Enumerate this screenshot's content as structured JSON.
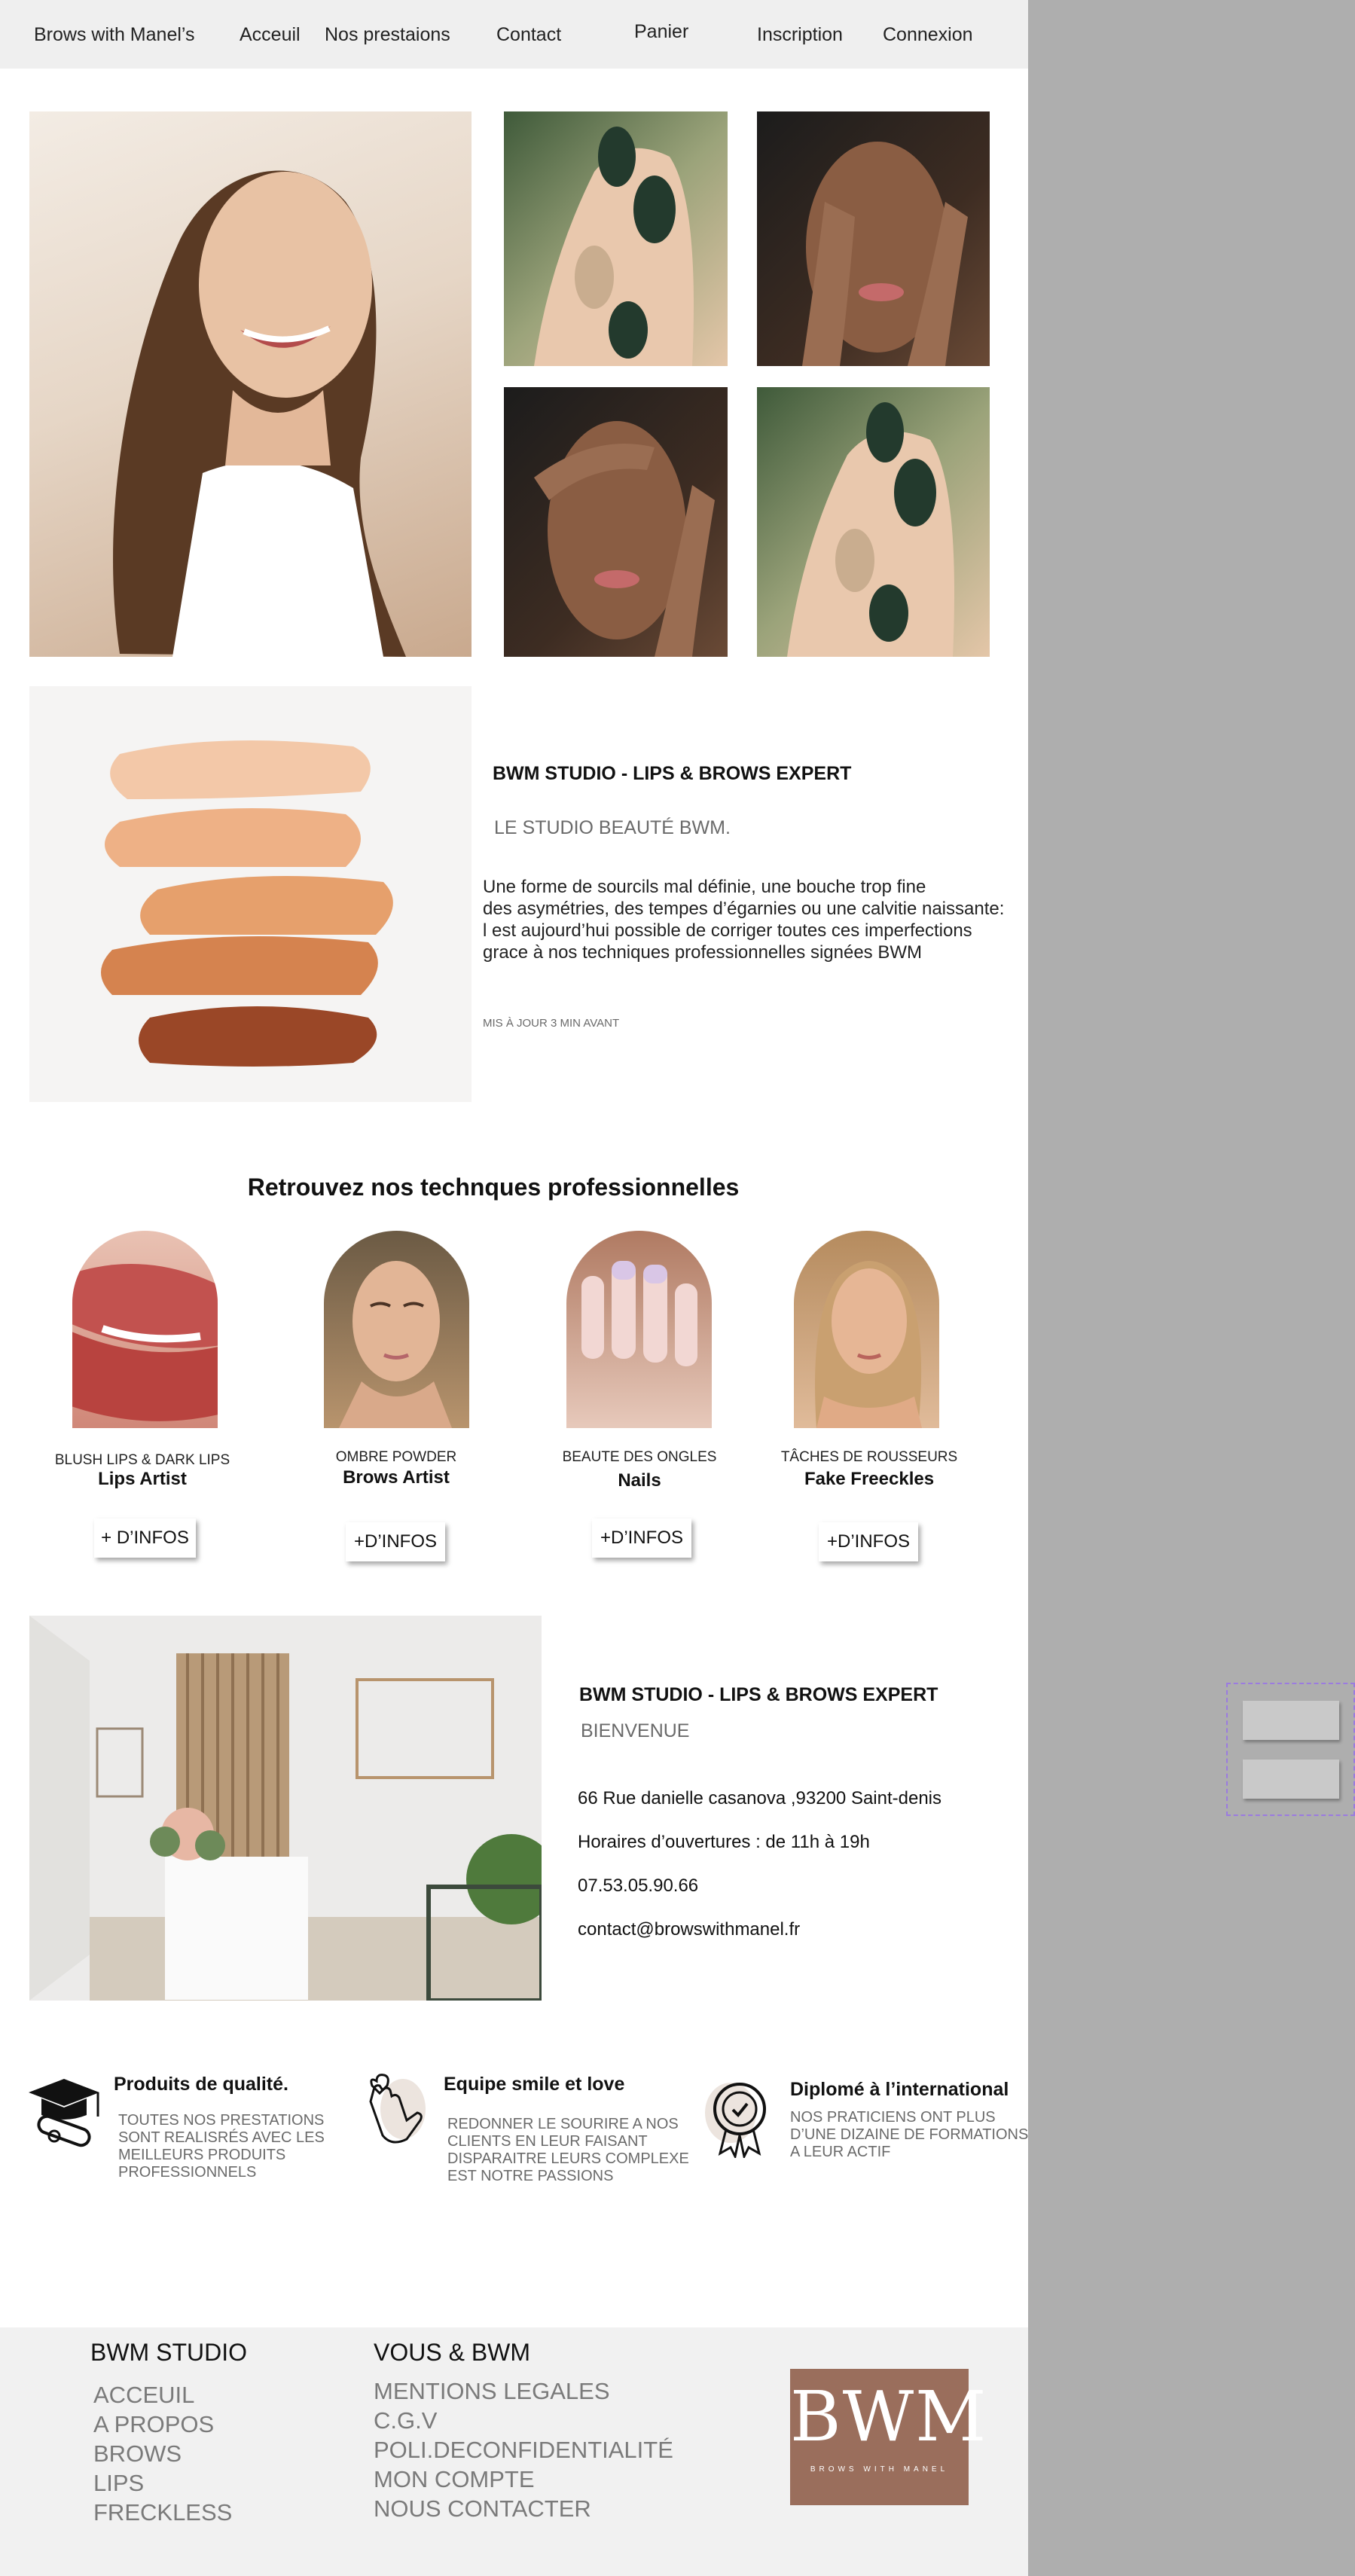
{
  "nav": {
    "brand": "Brows with Manel’s",
    "items": [
      "Acceuil",
      "Nos prestaions",
      "Contact",
      "Panier",
      "Inscription",
      "Connexion"
    ]
  },
  "about": {
    "title": "BWM STUDIO - LIPS & BROWS EXPERT",
    "subtitle": "LE STUDIO BEAUTÉ BWM.",
    "body_lines": [
      "Une forme de sourcils mal définie, une bouche trop fine",
      "des asymétries, des tempes d’égarnies ou une calvitie naissante:",
      "l est aujourd’hui possible de corriger toutes ces imperfections",
      "grace à nos techniques professionnelles signées BWM"
    ],
    "updated": "MIS À JOUR 3 MIN AVANT"
  },
  "techniques": {
    "heading": "Retrouvez nos technques professionnelles",
    "cards": [
      {
        "category": "BLUSH LIPS & DARK LIPS",
        "name": "Lips Artist",
        "button": "+ D’INFOS"
      },
      {
        "category": "OMBRE POWDER",
        "name": "Brows Artist",
        "button": "+D’INFOS"
      },
      {
        "category": "BEAUTE DES ONGLES",
        "name": "Nails",
        "button": "+D’INFOS"
      },
      {
        "category": "TÂCHES DE ROUSSEURS",
        "name": "Fake Freeckles",
        "button": "+D’INFOS"
      }
    ]
  },
  "studio": {
    "title": "BWM STUDIO - LIPS & BROWS EXPERT",
    "welcome": "BIENVENUE",
    "address": "66 Rue danielle casanova ,93200 Saint-denis",
    "hours": "Horaires d’ouvertures : de 11h à 19h",
    "phone": "07.53.05.90.66",
    "email": "contact@browswithmanel.fr"
  },
  "features": [
    {
      "title": "Produits de qualité.",
      "lines": [
        "TOUTES NOS PRESTATIONS",
        "SONT REALISRÉS AVEC LES",
        "MEILLEURS PRODUITS",
        "PROFESSIONNELS"
      ],
      "icon": "graduation-icon"
    },
    {
      "title": "Equipe smile et love",
      "lines": [
        "REDONNER LE SOURIRE A NOS",
        "CLIENTS EN LEUR FAISANT",
        "DISPARAITRE LEURS COMPLEXE",
        "EST NOTRE PASSIONS"
      ],
      "icon": "heart-hand-icon"
    },
    {
      "title": "Diplomé à l’international",
      "lines": [
        "NOS PRATICIENS ONT PLUS",
        "D’UNE DIZAINE DE FORMATIONS",
        "A LEUR ACTIF"
      ],
      "icon": "award-badge-icon"
    }
  ],
  "footer": {
    "col1_title": "BWM STUDIO",
    "col1_links": [
      "ACCEUIL",
      "A PROPOS",
      "BROWS",
      "LIPS",
      "FRECKLESS"
    ],
    "col2_title": "VOUS & BWM",
    "col2_links": [
      "MENTIONS LEGALES",
      "C.G.V",
      "POLI.DECONFIDENTIALITÉ",
      "MON COMPTE",
      "NOUS CONTACTER"
    ],
    "logo_text": "BWM",
    "logo_sub": "BROWS WITH MANEL",
    "logo_color": "#9a6e5c"
  },
  "colors": {
    "nav_bg": "#efefef",
    "footer_bg": "#f1f1f1",
    "side_bg": "#aeaeae"
  }
}
